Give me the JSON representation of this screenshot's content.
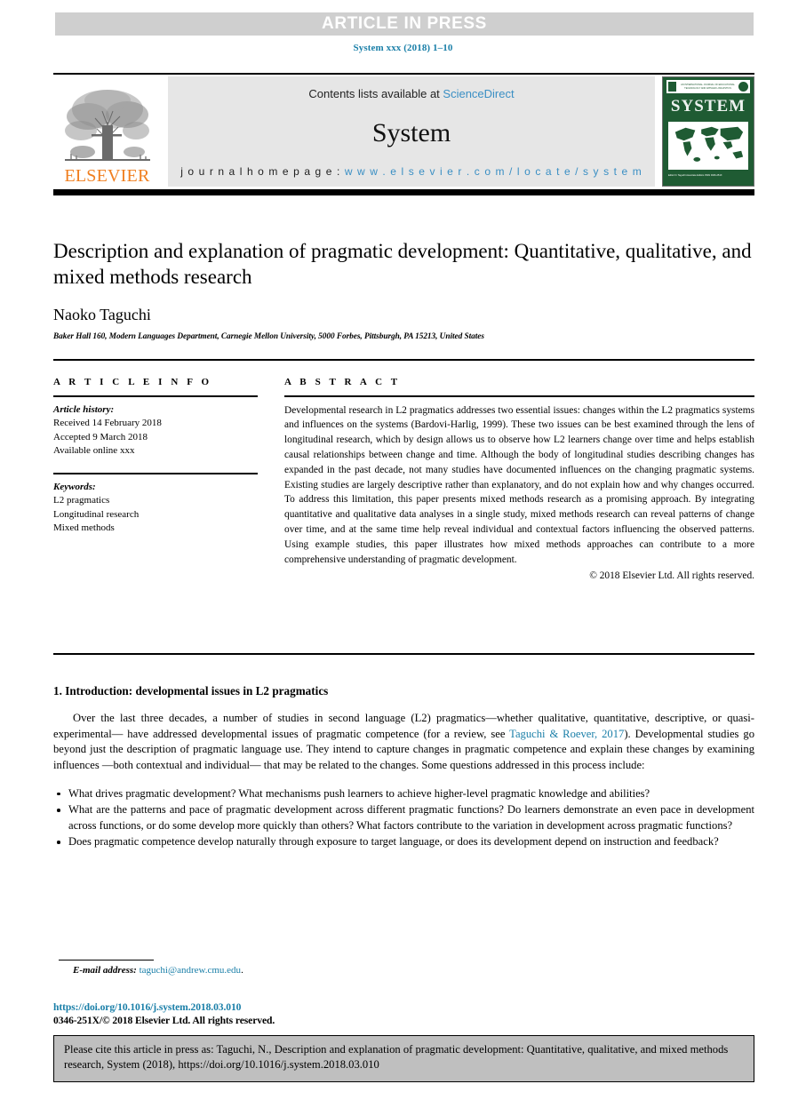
{
  "banner": {
    "text": "ARTICLE IN PRESS"
  },
  "running_head": "System xxx (2018) 1–10",
  "masthead": {
    "contents_prefix": "Contents lists available at ",
    "sciencedirect_link": "ScienceDirect",
    "journal_title": "System",
    "homepage_label": "j o u r n a l   h o m e p a g e :",
    "homepage_url": "w w w . e l s e v i e r . c o m / l o c a t e / s y s t e m",
    "publisher_wordmark": "ELSEVIER",
    "cover": {
      "title": "SYSTEM",
      "top_text": "AN INTERNATIONAL JOURNAL OF EDUCATIONAL TECHNOLOGY AND APPLIED LINGUISTICS",
      "footer_text": "Editor\nN. Taguchi\nAssociate Editors\nISSN 0346-251X"
    }
  },
  "article": {
    "title": "Description and explanation of pragmatic development: Quantitative, qualitative, and mixed methods research",
    "author": "Naoko Taguchi",
    "affiliation": "Baker Hall 160, Modern Languages Department, Carnegie Mellon University, 5000 Forbes, Pittsburgh, PA 15213, United States"
  },
  "article_info": {
    "kicker": "A R T I C L E   I N F O",
    "history_label": "Article history:",
    "history": [
      "Received 14 February 2018",
      "Accepted 9 March 2018",
      "Available online xxx"
    ],
    "keywords_label": "Keywords:",
    "keywords": [
      "L2 pragmatics",
      "Longitudinal research",
      "Mixed methods"
    ]
  },
  "abstract": {
    "kicker": "A B S T R A C T",
    "body": "Developmental research in L2 pragmatics addresses two essential issues: changes within the L2 pragmatics systems and influences on the systems (Bardovi-Harlig, 1999). These two issues can be best examined through the lens of longitudinal research, which by design allows us to observe how L2 learners change over time and helps establish causal relationships between change and time. Although the body of longitudinal studies describing changes has expanded in the past decade, not many studies have documented influences on the changing pragmatic systems. Existing studies are largely descriptive rather than explanatory, and do not explain how and why changes occurred. To address this limitation, this paper presents mixed methods research as a promising approach. By integrating quantitative and qualitative data analyses in a single study, mixed methods research can reveal patterns of change over time, and at the same time help reveal individual and contextual factors influencing the observed patterns. Using example studies, this paper illustrates how mixed methods approaches can contribute to a more comprehensive understanding of pragmatic development.",
    "copyright": "© 2018 Elsevier Ltd. All rights reserved."
  },
  "introduction": {
    "heading": "1. Introduction: developmental issues in L2 pragmatics",
    "para_part1": "Over the last three decades, a number of studies in second language (L2) pragmatics—whether qualitative, quantitative, descriptive, or quasi-experimental— have addressed developmental issues of pragmatic competence (for a review, see ",
    "citation_link": "Taguchi & Roever, 2017",
    "para_part2": "). Developmental studies go beyond just the description of pragmatic language use. They intend to capture changes in pragmatic competence and explain these changes by examining influences —both contextual and individual— that may be related to the changes. Some questions addressed in this process include:",
    "bullets": [
      "What drives pragmatic development? What mechanisms push learners to achieve higher-level pragmatic knowledge and abilities?",
      "What are the patterns and pace of pragmatic development across different pragmatic functions? Do learners demonstrate an even pace in development across functions, or do some develop more quickly than others? What factors contribute to the variation in development across pragmatic functions?",
      "Does pragmatic competence develop naturally through exposure to target language, or does its development depend on instruction and feedback?"
    ]
  },
  "footer": {
    "email_label": "E-mail address:",
    "email": "taguchi@andrew.cmu.edu",
    "email_suffix": ".",
    "doi": "https://doi.org/10.1016/j.system.2018.03.010",
    "issn_copyright": "0346-251X/© 2018 Elsevier Ltd. All rights reserved.",
    "cite_box": "Please cite this article in press as: Taguchi, N., Description and explanation of pragmatic development: Quantitative, qualitative, and mixed methods research, System (2018), https://doi.org/10.1016/j.system.2018.03.010"
  },
  "colors": {
    "link_blue": "#1a7fa8",
    "sciencedirect_blue": "#3a8fc4",
    "elsevier_orange": "#f07f20",
    "banner_gray": "#cfcfcf",
    "panel_gray": "#e6e6e6",
    "cite_box_gray": "#bfbfbf",
    "cover_green": "#1f5b33"
  }
}
